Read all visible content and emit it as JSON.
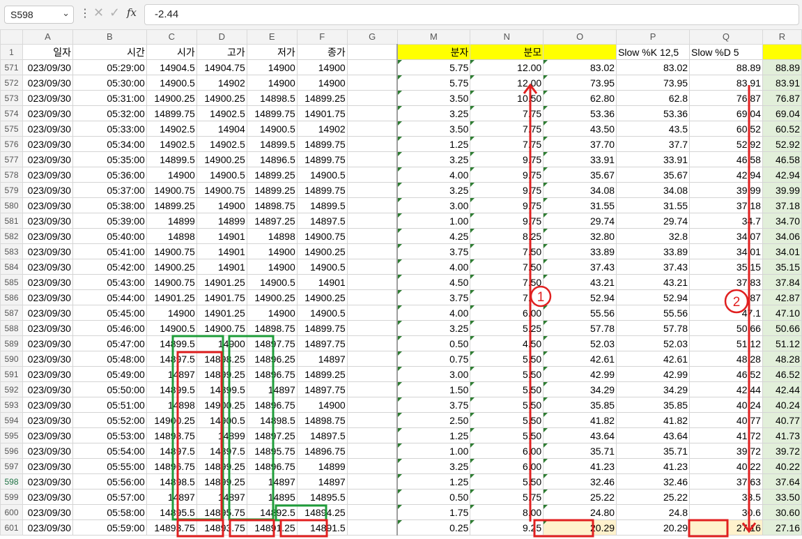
{
  "name_box": "S598",
  "formula": "-2.44",
  "icons": {
    "cancel": "x-icon",
    "enter": "check-icon",
    "function": "fx-icon",
    "dropdown": "chevron-down-icon"
  },
  "columns": [
    "A",
    "B",
    "C",
    "D",
    "E",
    "F",
    "G",
    "M",
    "N",
    "O",
    "P",
    "Q",
    "R"
  ],
  "header_row": {
    "num": "1",
    "cells": [
      "일자",
      "시간",
      "시가",
      "고가",
      "저가",
      "종가",
      "",
      "분자",
      "분모",
      "",
      "Slow %K 12,5",
      "Slow %D 5",
      ""
    ]
  },
  "rows": [
    {
      "num": "571",
      "cells": [
        "023/09/30",
        "05:29:00",
        "14904.5",
        "14904.75",
        "14900",
        "14900",
        "",
        "5.75",
        "12.00",
        "83.02",
        "83.02",
        "88.89",
        "88.89"
      ]
    },
    {
      "num": "572",
      "cells": [
        "023/09/30",
        "05:30:00",
        "14900.5",
        "14902",
        "14900",
        "14900",
        "",
        "5.75",
        "12.00",
        "73.95",
        "73.95",
        "83.91",
        "83.91"
      ]
    },
    {
      "num": "573",
      "cells": [
        "023/09/30",
        "05:31:00",
        "14900.25",
        "14900.25",
        "14898.5",
        "14899.25",
        "",
        "3.50",
        "10.50",
        "62.80",
        "62.8",
        "76.87",
        "76.87"
      ]
    },
    {
      "num": "574",
      "cells": [
        "023/09/30",
        "05:32:00",
        "14899.75",
        "14902.5",
        "14899.75",
        "14901.75",
        "",
        "3.25",
        "7.75",
        "53.36",
        "53.36",
        "69.04",
        "69.04"
      ]
    },
    {
      "num": "575",
      "cells": [
        "023/09/30",
        "05:33:00",
        "14902.5",
        "14904",
        "14900.5",
        "14902",
        "",
        "3.50",
        "7.75",
        "43.50",
        "43.5",
        "60.52",
        "60.52"
      ]
    },
    {
      "num": "576",
      "cells": [
        "023/09/30",
        "05:34:00",
        "14902.5",
        "14902.5",
        "14899.5",
        "14899.75",
        "",
        "1.25",
        "7.75",
        "37.70",
        "37.7",
        "52.92",
        "52.92"
      ]
    },
    {
      "num": "577",
      "cells": [
        "023/09/30",
        "05:35:00",
        "14899.5",
        "14900.25",
        "14896.5",
        "14899.75",
        "",
        "3.25",
        "9.75",
        "33.91",
        "33.91",
        "46.58",
        "46.58"
      ]
    },
    {
      "num": "578",
      "cells": [
        "023/09/30",
        "05:36:00",
        "14900",
        "14900.5",
        "14899.25",
        "14900.5",
        "",
        "4.00",
        "9.75",
        "35.67",
        "35.67",
        "42.94",
        "42.94"
      ]
    },
    {
      "num": "579",
      "cells": [
        "023/09/30",
        "05:37:00",
        "14900.75",
        "14900.75",
        "14899.25",
        "14899.75",
        "",
        "3.25",
        "9.75",
        "34.08",
        "34.08",
        "39.99",
        "39.99"
      ]
    },
    {
      "num": "580",
      "cells": [
        "023/09/30",
        "05:38:00",
        "14899.25",
        "14900",
        "14898.75",
        "14899.5",
        "",
        "3.00",
        "9.75",
        "31.55",
        "31.55",
        "37.18",
        "37.18"
      ]
    },
    {
      "num": "581",
      "cells": [
        "023/09/30",
        "05:39:00",
        "14899",
        "14899",
        "14897.25",
        "14897.5",
        "",
        "1.00",
        "9.75",
        "29.74",
        "29.74",
        "34.7",
        "34.70"
      ]
    },
    {
      "num": "582",
      "cells": [
        "023/09/30",
        "05:40:00",
        "14898",
        "14901",
        "14898",
        "14900.75",
        "",
        "4.25",
        "8.25",
        "32.80",
        "32.8",
        "34.07",
        "34.06"
      ]
    },
    {
      "num": "583",
      "cells": [
        "023/09/30",
        "05:41:00",
        "14900.75",
        "14901",
        "14900",
        "14900.25",
        "",
        "3.75",
        "7.50",
        "33.89",
        "33.89",
        "34.01",
        "34.01"
      ]
    },
    {
      "num": "584",
      "cells": [
        "023/09/30",
        "05:42:00",
        "14900.25",
        "14901",
        "14900",
        "14900.5",
        "",
        "4.00",
        "7.50",
        "37.43",
        "37.43",
        "35.15",
        "35.15"
      ]
    },
    {
      "num": "585",
      "cells": [
        "023/09/30",
        "05:43:00",
        "14900.75",
        "14901.25",
        "14900.5",
        "14901",
        "",
        "4.50",
        "7.50",
        "43.21",
        "43.21",
        "37.83",
        "37.84"
      ]
    },
    {
      "num": "586",
      "cells": [
        "023/09/30",
        "05:44:00",
        "14901.25",
        "14901.75",
        "14900.25",
        "14900.25",
        "",
        "3.75",
        "7.50",
        "52.94",
        "52.94",
        "42.87",
        "42.87"
      ]
    },
    {
      "num": "587",
      "cells": [
        "023/09/30",
        "05:45:00",
        "14900",
        "14901.25",
        "14900",
        "14900.5",
        "",
        "4.00",
        "6.00",
        "55.56",
        "55.56",
        "47.1",
        "47.10"
      ]
    },
    {
      "num": "588",
      "cells": [
        "023/09/30",
        "05:46:00",
        "14900.5",
        "14900.75",
        "14898.75",
        "14899.75",
        "",
        "3.25",
        "5.25",
        "57.78",
        "57.78",
        "50.66",
        "50.66"
      ]
    },
    {
      "num": "589",
      "cells": [
        "023/09/30",
        "05:47:00",
        "14899.5",
        "14900",
        "14897.75",
        "14897.75",
        "",
        "0.50",
        "4.50",
        "52.03",
        "52.03",
        "51.12",
        "51.12"
      ]
    },
    {
      "num": "590",
      "cells": [
        "023/09/30",
        "05:48:00",
        "14897.5",
        "14898.25",
        "14896.25",
        "14897",
        "",
        "0.75",
        "5.50",
        "42.61",
        "42.61",
        "48.28",
        "48.28"
      ]
    },
    {
      "num": "591",
      "cells": [
        "023/09/30",
        "05:49:00",
        "14897",
        "14899.25",
        "14896.75",
        "14899.25",
        "",
        "3.00",
        "5.50",
        "42.99",
        "42.99",
        "46.52",
        "46.52"
      ]
    },
    {
      "num": "592",
      "cells": [
        "023/09/30",
        "05:50:00",
        "14899.5",
        "14899.5",
        "14897",
        "14897.75",
        "",
        "1.50",
        "5.50",
        "34.29",
        "34.29",
        "42.44",
        "42.44"
      ]
    },
    {
      "num": "593",
      "cells": [
        "023/09/30",
        "05:51:00",
        "14898",
        "14900.25",
        "14896.75",
        "14900",
        "",
        "3.75",
        "5.50",
        "35.85",
        "35.85",
        "40.24",
        "40.24"
      ]
    },
    {
      "num": "594",
      "cells": [
        "023/09/30",
        "05:52:00",
        "14900.25",
        "14900.5",
        "14898.5",
        "14898.75",
        "",
        "2.50",
        "5.50",
        "41.82",
        "41.82",
        "40.77",
        "40.77"
      ]
    },
    {
      "num": "595",
      "cells": [
        "023/09/30",
        "05:53:00",
        "14898.75",
        "14899",
        "14897.25",
        "14897.5",
        "",
        "1.25",
        "5.50",
        "43.64",
        "43.64",
        "41.72",
        "41.73"
      ]
    },
    {
      "num": "596",
      "cells": [
        "023/09/30",
        "05:54:00",
        "14897.5",
        "14897.5",
        "14895.75",
        "14896.75",
        "",
        "1.00",
        "6.00",
        "35.71",
        "35.71",
        "39.72",
        "39.72"
      ]
    },
    {
      "num": "597",
      "cells": [
        "023/09/30",
        "05:55:00",
        "14896.75",
        "14899.25",
        "14896.75",
        "14899",
        "",
        "3.25",
        "6.00",
        "41.23",
        "41.23",
        "40.22",
        "40.22"
      ]
    },
    {
      "num": "598",
      "cells": [
        "023/09/30",
        "05:56:00",
        "14898.5",
        "14899.25",
        "14897",
        "14897",
        "",
        "1.25",
        "5.50",
        "32.46",
        "32.46",
        "37.63",
        "37.64"
      ]
    },
    {
      "num": "599",
      "cells": [
        "023/09/30",
        "05:57:00",
        "14897",
        "14897",
        "14895",
        "14895.5",
        "",
        "0.50",
        "5.75",
        "25.22",
        "25.22",
        "33.5",
        "33.50"
      ]
    },
    {
      "num": "600",
      "cells": [
        "023/09/30",
        "05:58:00",
        "14895.5",
        "14895.75",
        "14892.5",
        "14894.25",
        "",
        "1.75",
        "8.00",
        "24.80",
        "24.8",
        "30.6",
        "30.60"
      ]
    },
    {
      "num": "601",
      "cells": [
        "023/09/30",
        "05:59:00",
        "14893.75",
        "14893.75",
        "14891.25",
        "14891.5",
        "",
        "0.25",
        "9.25",
        "20.29",
        "20.29",
        "27.16",
        "27.16"
      ]
    }
  ],
  "annotations": {
    "marker1": "1",
    "marker2": "2"
  },
  "colors": {
    "yellow_header": "#ffff00",
    "highlight_green": "#e2efda",
    "highlight_cream": "#fff2cc",
    "annotation_red": "#e02020",
    "annotation_green": "#1f9d3a",
    "selected_row_text": "#217346"
  }
}
